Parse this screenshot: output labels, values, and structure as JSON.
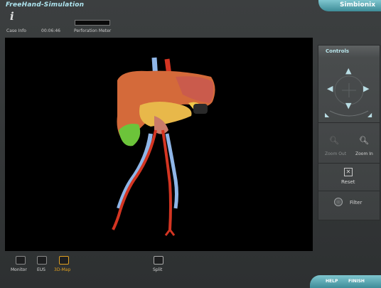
{
  "app": {
    "title": "FreeHand-Simulation",
    "brand": "Simbionix"
  },
  "top": {
    "case_icon": "i",
    "case_label": "Case Info",
    "timer": "00:06:46",
    "meter_label": "Perforation Meter"
  },
  "controls": {
    "title": "Controls",
    "zoom_out": "Zoom Out",
    "zoom_in": "Zoom In",
    "reset": "Reset",
    "filter": "Filter"
  },
  "bottom": {
    "tools": [
      {
        "label": "Monitor"
      },
      {
        "label": "EUS"
      },
      {
        "label": "3D-Map",
        "active": true
      }
    ],
    "split": "Split",
    "help": "HELP",
    "finish": "FINISH"
  },
  "colors": {
    "accent": "#7fc6cf",
    "active_label": "#e0a020"
  }
}
